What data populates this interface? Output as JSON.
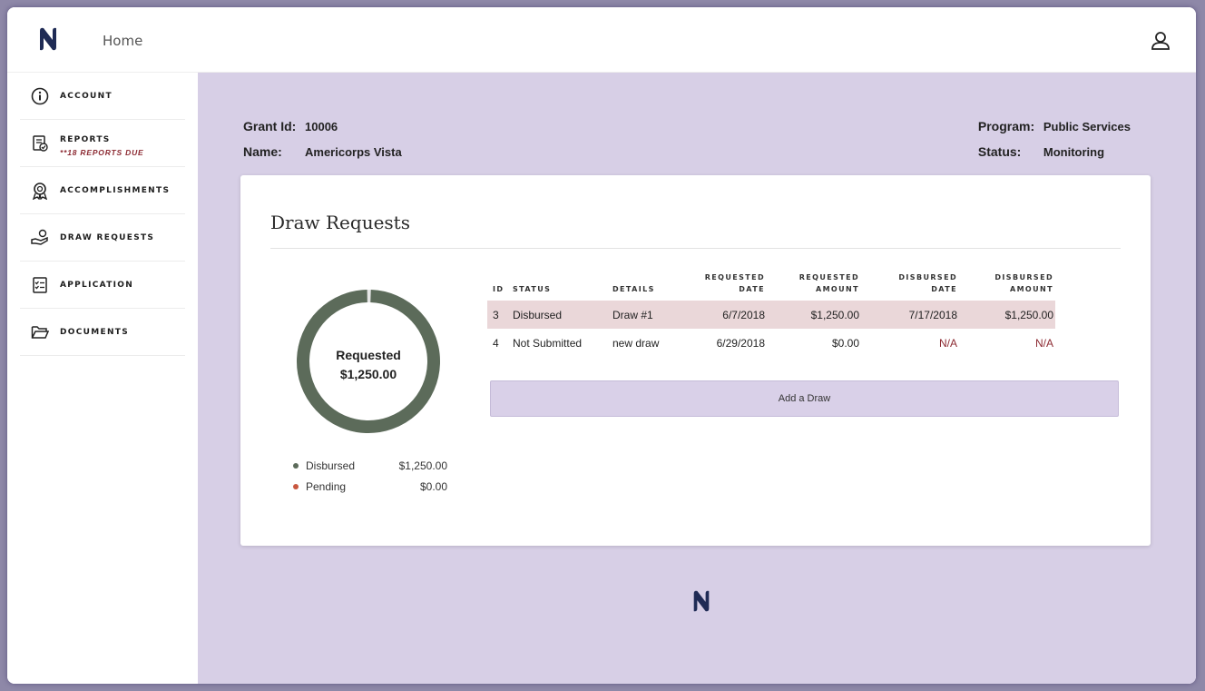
{
  "app": {
    "home_label": "Home"
  },
  "sidebar": {
    "items": [
      {
        "label": "ACCOUNT",
        "icon": "info-icon"
      },
      {
        "label": "REPORTS",
        "sub": "**18 REPORTS DUE",
        "icon": "reports-icon"
      },
      {
        "label": "ACCOMPLISHMENTS",
        "icon": "award-icon"
      },
      {
        "label": "DRAW REQUESTS",
        "icon": "hand-money-icon"
      },
      {
        "label": "APPLICATION",
        "icon": "checklist-icon"
      },
      {
        "label": "DOCUMENTS",
        "icon": "folder-icon"
      }
    ]
  },
  "grant": {
    "id_label": "Grant Id:",
    "id_value": "10006",
    "name_label": "Name:",
    "name_value": "Americorps Vista",
    "program_label": "Program:",
    "program_value": "Public Services",
    "status_label": "Status:",
    "status_value": "Monitoring"
  },
  "draws": {
    "title": "Draw Requests",
    "summary_label": "Requested",
    "summary_value": "$1,250.00",
    "legend": [
      {
        "name": "Disbursed",
        "value": "$1,250.00",
        "color": "#5c6b5a"
      },
      {
        "name": "Pending",
        "value": "$0.00",
        "color": "#c9573f"
      }
    ],
    "donut_fraction_disbursed": 1.0,
    "columns": {
      "id": "ID",
      "status": "STATUS",
      "details": "DETAILS",
      "req_date_1": "REQUESTED",
      "req_date_2": "DATE",
      "req_amt_1": "REQUESTED",
      "req_amt_2": "AMOUNT",
      "dis_date_1": "DISBURSED",
      "dis_date_2": "DATE",
      "dis_amt_1": "DISBURSED",
      "dis_amt_2": "AMOUNT"
    },
    "rows": [
      {
        "id": "3",
        "status": "Disbursed",
        "details": "Draw #1",
        "requested_date": "6/7/2018",
        "requested_amount": "$1,250.00",
        "disbursed_date": "7/17/2018",
        "disbursed_amount": "$1,250.00"
      },
      {
        "id": "4",
        "status": "Not Submitted",
        "details": "new draw",
        "requested_date": "6/29/2018",
        "requested_amount": "$0.00",
        "disbursed_date": "N/A",
        "disbursed_amount": "N/A"
      }
    ],
    "add_button": "Add a Draw"
  },
  "colors": {
    "brand": "#1f2b55",
    "main_bg": "#d7cfe6",
    "donut": "#5c6b5a",
    "alert": "#8c2a32"
  }
}
